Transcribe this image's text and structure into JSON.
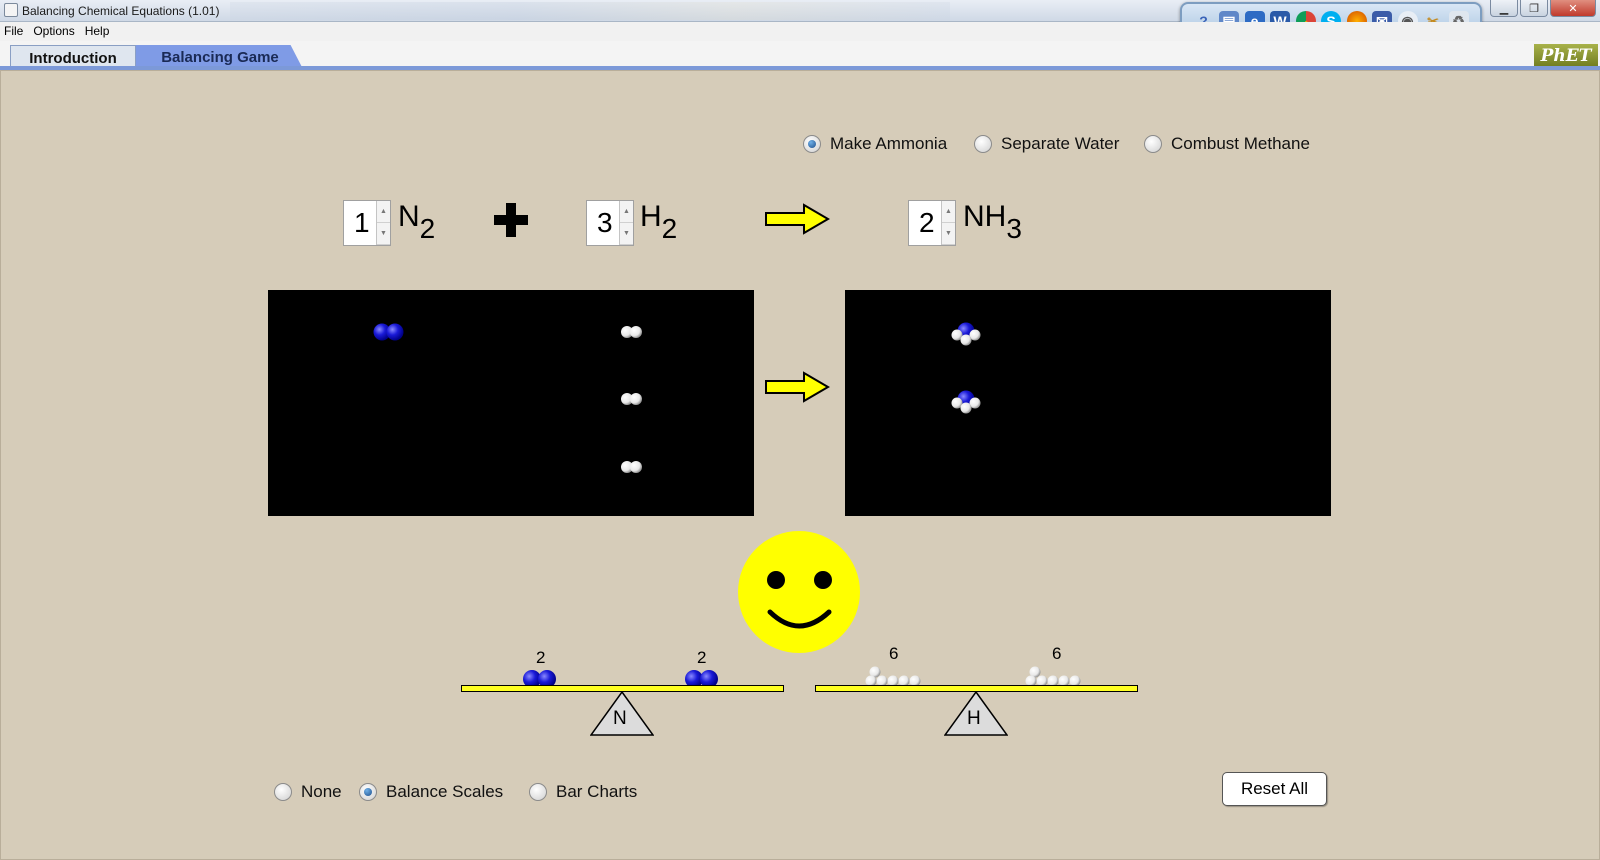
{
  "window": {
    "title": "Balancing Chemical Equations (1.01)"
  },
  "menu": [
    "File",
    "Options",
    "Help"
  ],
  "tabs": {
    "introduction": "Introduction",
    "game": "Balancing Game"
  },
  "logo": "PhET",
  "reactions": {
    "opt1": "Make Ammonia",
    "opt2": "Separate Water",
    "opt3": "Combust Methane",
    "selected": "Make Ammonia"
  },
  "equation": {
    "reactant1": {
      "coefficient": "1",
      "symbol": "N",
      "subscript": "2"
    },
    "reactant2": {
      "coefficient": "3",
      "symbol": "H",
      "subscript": "2"
    },
    "product1": {
      "coefficient": "2",
      "symbol": "NH",
      "subscript": "3"
    }
  },
  "box_contents": {
    "n2_count": 1,
    "h2_count": 3,
    "nh3_count": 2
  },
  "balance": {
    "n": {
      "left": "2",
      "right": "2",
      "element": "N"
    },
    "h": {
      "left": "6",
      "right": "6",
      "element": "H"
    }
  },
  "tools": {
    "opt1": "None",
    "opt2": "Balance Scales",
    "opt3": "Bar Charts",
    "selected": "Balance Scales"
  },
  "buttons": {
    "reset": "Reset All"
  },
  "colors": {
    "nitrogen": "#1010d0",
    "hydrogen": "#ffffff",
    "arrow": "#ffff00",
    "beam": "#ffff22",
    "smiley": "#ffff00"
  }
}
